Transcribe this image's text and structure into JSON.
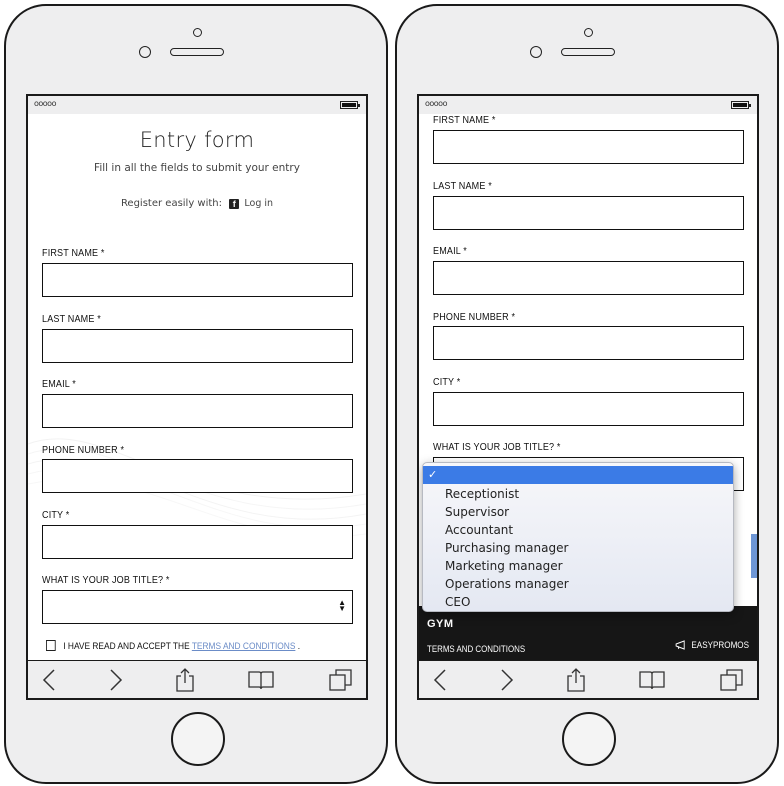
{
  "left_phone": {
    "status": {
      "signal": "ooooo"
    },
    "form": {
      "title": "Entry form",
      "subtitle": "Fill in all the fields to submit your entry",
      "register_text": "Register easily with:",
      "facebook_icon_glyph": "f",
      "login_label": "Log in",
      "fields": [
        {
          "label": "FIRST NAME *",
          "value": ""
        },
        {
          "label": "LAST NAME *",
          "value": ""
        },
        {
          "label": "EMAIL *",
          "value": ""
        },
        {
          "label": "PHONE NUMBER *",
          "value": ""
        },
        {
          "label": "CITY *",
          "value": ""
        }
      ],
      "job_title": {
        "label": "WHAT IS YOUR JOB TITLE? *",
        "value": ""
      },
      "terms": {
        "prefix": "I HAVE READ AND ACCEPT THE ",
        "link": "TERMS AND CONDITIONS",
        "suffix": "."
      }
    }
  },
  "right_phone": {
    "status": {
      "signal": "ooooo"
    },
    "fields": [
      {
        "label": "FIRST NAME *",
        "value": ""
      },
      {
        "label": "LAST NAME *",
        "value": ""
      },
      {
        "label": "EMAIL *",
        "value": ""
      },
      {
        "label": "PHONE NUMBER *",
        "value": ""
      },
      {
        "label": "CITY *",
        "value": ""
      }
    ],
    "job_title": {
      "label": "WHAT IS YOUR JOB TITLE? *"
    },
    "dropdown": {
      "selected_check": "✓",
      "options": [
        "",
        "Receptionist",
        "Supervisor",
        "Accountant",
        "Purchasing manager",
        "Marketing manager",
        "Operations manager",
        "CEO"
      ]
    },
    "footer": {
      "brand": "GYM",
      "terms": "TERMS AND CONDITIONS",
      "powered_by": "EASYPROMOS"
    }
  },
  "colors": {
    "accent": "#3b7be6",
    "link": "#6b8cc7",
    "footer_bg": "#161616"
  },
  "toolbar_icons": [
    "back-icon",
    "forward-icon",
    "share-icon",
    "bookmarks-icon",
    "tabs-icon"
  ]
}
